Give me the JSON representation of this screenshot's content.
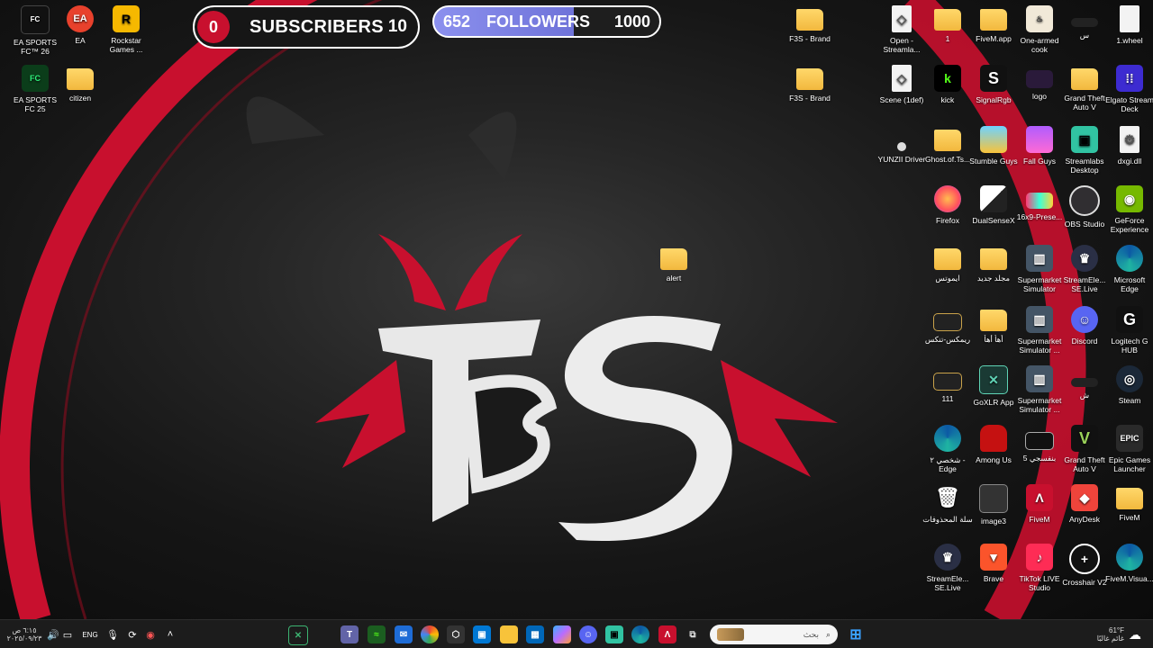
{
  "counters": {
    "subscribers": {
      "current": "0",
      "label": "SUBSCRIBERS",
      "goal": "10"
    },
    "followers": {
      "current": "652",
      "label": "FOLLOWERS",
      "goal": "1000",
      "progress": 0.652
    }
  },
  "wallpaper": {
    "logo_text": "F3S",
    "colors": {
      "red": "#c8102e",
      "white": "#e8e8e8",
      "dark": "#161616"
    }
  },
  "desktop_icons": {
    "ea_fc26": "EA SPORTS FC™ 26",
    "ea": "EA",
    "rockstar": "Rockstar Games ...",
    "ea_fc25": "EA SPORTS FC 25",
    "citizen": "citizen",
    "f3s_brand_1": "F3S - Brand",
    "f3s_brand_2": "F3S - Brand",
    "alert": "alert",
    "open_streamlabs": "Open - Streamla...",
    "scene": "Scene (1def)",
    "yunzii": "YUNZII Driver",
    "one": "1",
    "kick": "kick",
    "ghost": "Ghost.of.Ts...",
    "firefox": "Firefox",
    "aymots": "ايموتس",
    "remix": "ريمكس-تنكس",
    "one_one_one": "111",
    "edge_personal": "شخصي ٢ - Edge",
    "recycle": "سلة المحذوفات",
    "streamele1": "StreamEle... SE.Live",
    "fivem_app": "FiveM.app",
    "signalrgb": "SignalRgb",
    "stumble": "Stumble Guys",
    "dualsense": "DualSenseX",
    "new_folder": "مجلد جديد",
    "aha": "أهأ أهأ",
    "goxlr": "GoXLR App",
    "among": "Among Us",
    "image3": "image3",
    "brave": "Brave",
    "one_armed": "One-armed cook",
    "logo": "logo",
    "fall": "Fall Guys",
    "preset": "16x9-Prese...",
    "supermarket1": "Supermarket Simulator",
    "supermarket2": "Supermarket Simulator ...",
    "supermarket3": "Supermarket Simulator ...",
    "banafsaji": "بنفسجي 5",
    "fivem_tool": "FiveM",
    "tiktok": "TikTok LIVE Studio",
    "seen": "س",
    "gta1": "Grand Theft Auto V",
    "streamlabs_desktop": "Streamlabs Desktop",
    "obs": "OBS Studio",
    "streamele2": "StreamEle... SE.Live",
    "discord": "Discord",
    "sheen": "ش",
    "gta2": "Grand Theft Auto V",
    "anydesk": "AnyDesk",
    "crosshair": "Crosshair V2",
    "wheel": "1.wheel",
    "elgato": "Elgato Stream Deck",
    "dxgi": "dxgi.dll",
    "geforce": "GeForce Experience",
    "msedge": "Microsoft Edge",
    "logitech": "Logitech G HUB",
    "steam": "Steam",
    "epic": "Epic Games Launcher",
    "fivem_folder": "FiveM",
    "fivem_visual": "FiveM.Visua..."
  },
  "taskbar": {
    "search_placeholder": "بحث",
    "clock_time": "٦:١٥ ص",
    "clock_date": "٢٠٢٥/٠٩/٢٣",
    "language": "ENG",
    "weather_temp": "61°F",
    "weather_desc": "غائم غالبًا"
  }
}
